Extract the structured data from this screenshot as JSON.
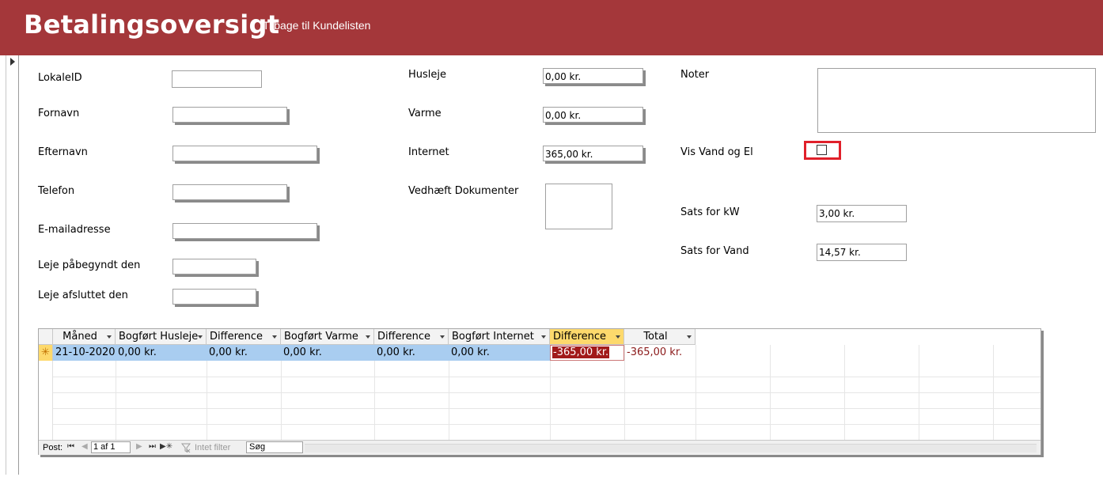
{
  "header": {
    "title": "Betalingsoversigt",
    "back_link": "Tilbage til Kundelisten"
  },
  "form": {
    "lokaleid": {
      "label": "LokaleID",
      "value": ""
    },
    "fornavn": {
      "label": "Fornavn",
      "value": ""
    },
    "efternavn": {
      "label": "Efternavn",
      "value": ""
    },
    "telefon": {
      "label": "Telefon",
      "value": ""
    },
    "email": {
      "label": "E-mailadresse",
      "value": ""
    },
    "leje_start": {
      "label": "Leje påbegyndt den",
      "value": ""
    },
    "leje_slut": {
      "label": "Leje afsluttet den",
      "value": ""
    },
    "husleje": {
      "label": "Husleje",
      "value": "0,00 kr."
    },
    "varme": {
      "label": "Varme",
      "value": "0,00 kr."
    },
    "internet": {
      "label": "Internet",
      "value": "365,00 kr."
    },
    "dokumenter": {
      "label": "Vedhæft Dokumenter"
    },
    "noter": {
      "label": "Noter",
      "value": ""
    },
    "vis_vand_el": {
      "label": "Vis Vand og El",
      "checked": false
    },
    "sats_kw": {
      "label": "Sats for kW",
      "value": "3,00 kr."
    },
    "sats_vand": {
      "label": "Sats for Vand",
      "value": "14,57 kr."
    }
  },
  "grid": {
    "columns": [
      "Måned",
      "Bogført Husleje",
      "Difference",
      "Bogført Varme",
      "Difference",
      "Bogført Internet",
      "Difference",
      "Total"
    ],
    "row": {
      "selector": "✳",
      "cells": [
        "21-10-2020",
        "0,00 kr.",
        "0,00 kr.",
        "0,00 kr.",
        "0,00 kr.",
        "0,00 kr.",
        "-365,00 kr.",
        "-365,00 kr."
      ]
    },
    "navigation": {
      "label": "Post:",
      "first": "⏮",
      "prev": "◀",
      "position": "1 af 1",
      "next": "▶",
      "last": "⏭",
      "new": "▶✳",
      "filter_icon": "funnel-icon",
      "filter": "Intet filter",
      "search": "Søg"
    }
  }
}
